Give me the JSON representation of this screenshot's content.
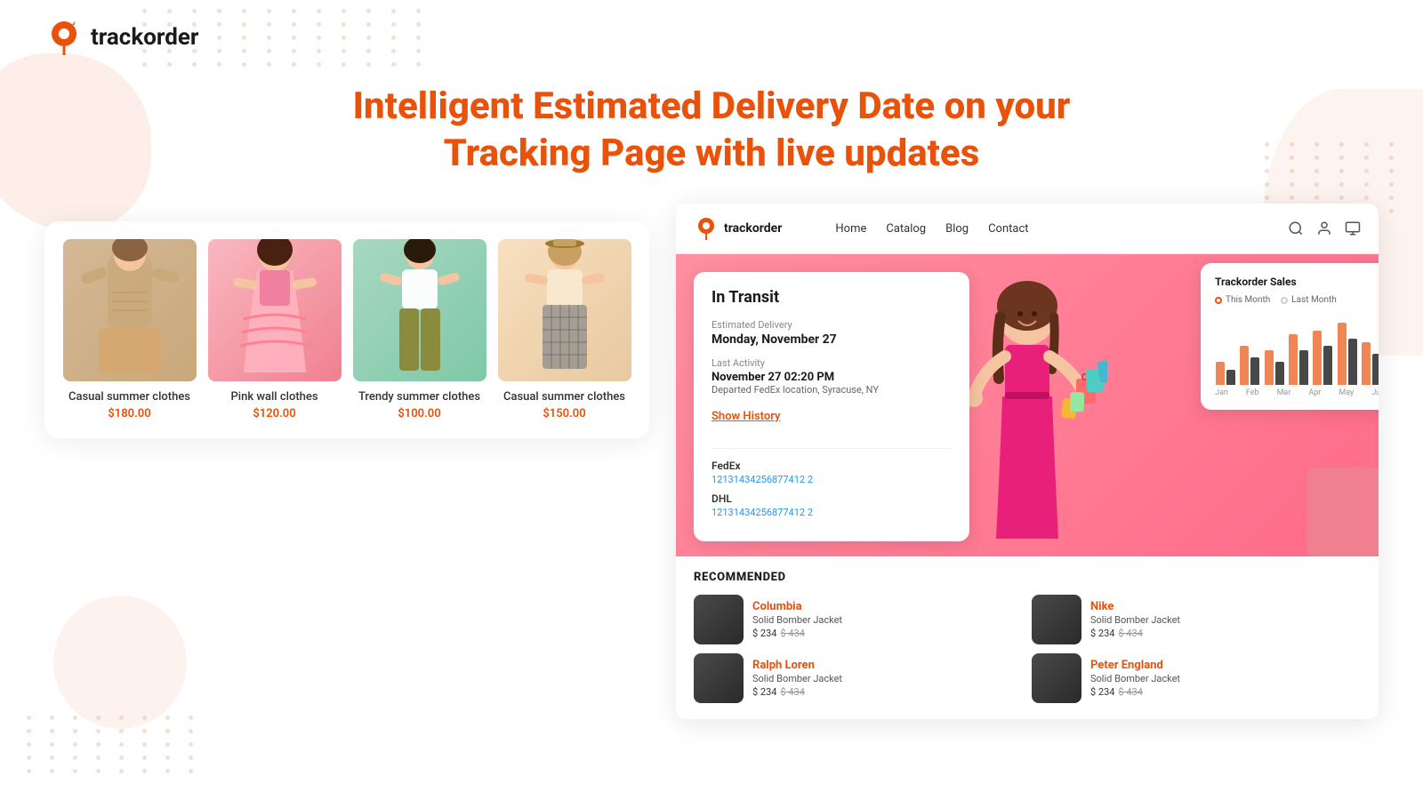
{
  "logo": {
    "text": "trackorder",
    "icon_name": "location-pin-icon"
  },
  "hero": {
    "title_line1": "Intelligent Estimated Delivery Date on your",
    "title_line2": "Tracking Page with live updates"
  },
  "products": [
    {
      "name": "Casual summer clothes",
      "price": "$180.00",
      "theme": "warm"
    },
    {
      "name": "Pink wall clothes",
      "price": "$120.00",
      "theme": "pink"
    },
    {
      "name": "Trendy summer clothes",
      "price": "$100.00",
      "theme": "green"
    },
    {
      "name": "Casual summer clothes",
      "price": "$150.00",
      "theme": "cream"
    }
  ],
  "store": {
    "logo_text": "trackorder",
    "nav_links": [
      "Home",
      "Catalog",
      "Blog",
      "Contact"
    ]
  },
  "tracking": {
    "status": "In Transit",
    "estimated_delivery_label": "Estimated Delivery",
    "estimated_delivery_value": "Monday, November 27",
    "last_activity_label": "Last Activity",
    "last_activity_date": "November 27 02:20 PM",
    "last_activity_location": "Departed FedEx location, Syracuse, NY",
    "show_history_label": "Show History",
    "carriers": [
      {
        "name": "FedEx",
        "tracking_number": "12131434256877412 2"
      },
      {
        "name": "DHL",
        "tracking_number": "12131434256877412 2"
      }
    ]
  },
  "sales_chart": {
    "title": "Trackorder Sales",
    "legend_this_month": "This Month",
    "legend_last_month": "Last Month",
    "months": [
      "Jan",
      "Feb",
      "Mar",
      "Apr",
      "May",
      "Jun",
      "Jul"
    ],
    "this_month_data": [
      30,
      50,
      45,
      65,
      70,
      80,
      55
    ],
    "last_month_data": [
      20,
      35,
      30,
      45,
      50,
      60,
      40
    ]
  },
  "recommended": {
    "title": "RECOMMENDED",
    "items": [
      {
        "brand": "Columbia",
        "product": "Solid Bomber Jacket",
        "price": "$ 234",
        "original_price": "$ 434"
      },
      {
        "brand": "Nike",
        "product": "Solid Bomber Jacket",
        "price": "$ 234",
        "original_price": "$ 434"
      },
      {
        "brand": "Ralph Loren",
        "product": "Solid Bomber Jacket",
        "price": "$ 234",
        "original_price": "$ 434"
      },
      {
        "brand": "Peter England",
        "product": "Solid Bomber Jacket",
        "price": "$ 234",
        "original_price": "$ 434"
      }
    ]
  }
}
